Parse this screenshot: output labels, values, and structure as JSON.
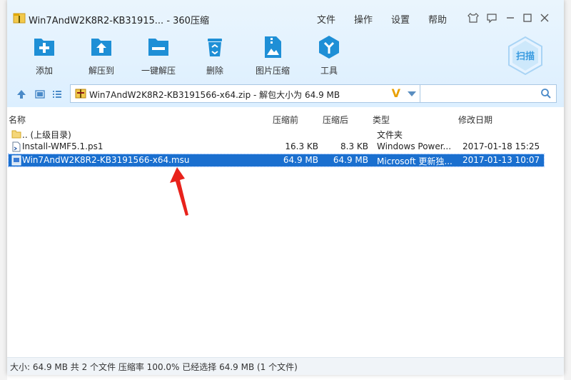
{
  "window": {
    "title": "Win7AndW2K8R2-KB31915... - 360压缩",
    "menu": [
      "文件",
      "操作",
      "设置",
      "帮助"
    ]
  },
  "toolbar": {
    "tools": [
      {
        "label": "添加",
        "icon": "add-icon"
      },
      {
        "label": "解压到",
        "icon": "extract-to-icon"
      },
      {
        "label": "一键解压",
        "icon": "one-click-extract-icon"
      },
      {
        "label": "删除",
        "icon": "delete-icon"
      },
      {
        "label": "图片压缩",
        "icon": "image-compress-icon"
      },
      {
        "label": "工具",
        "icon": "tools-icon"
      }
    ],
    "scan_label": "扫描"
  },
  "navbar": {
    "path": "Win7AndW2K8R2-KB3191566-x64.zip - 解包大小为 64.9 MB"
  },
  "table": {
    "headers": [
      "名称",
      "压缩前",
      "压缩后",
      "类型",
      "修改日期"
    ],
    "rows": [
      {
        "name": ".. (上级目录)",
        "before": "",
        "after": "",
        "type": "文件夹",
        "date": ""
      },
      {
        "name": "Install-WMF5.1.ps1",
        "before": "16.3 KB",
        "after": "8.3 KB",
        "type": "Windows Power...",
        "date": "2017-01-18 15:25"
      },
      {
        "name": "Win7AndW2K8R2-KB3191566-x64.msu",
        "before": "64.9 MB",
        "after": "64.9 MB",
        "type": "Microsoft 更新独...",
        "date": "2017-01-13 10:07"
      }
    ]
  },
  "status": {
    "text": "大小: 64.9 MB 共 2 个文件 压缩率 100.0% 已经选择 64.9 MB (1 个文件)"
  },
  "colors": {
    "accent": "#1a6fcf",
    "toolbar_icon": "#1e8fd6",
    "annotation_arrow": "#e8221b"
  }
}
